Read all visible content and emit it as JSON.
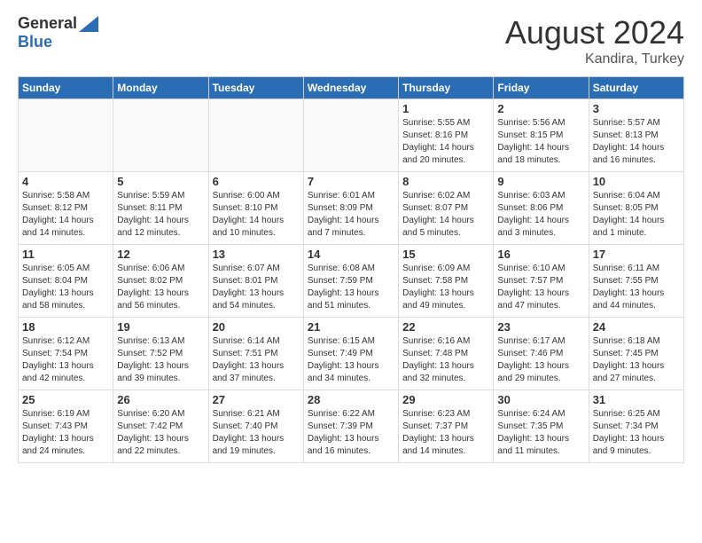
{
  "header": {
    "logo_general": "General",
    "logo_blue": "Blue",
    "month_year": "August 2024",
    "location": "Kandira, Turkey"
  },
  "days_of_week": [
    "Sunday",
    "Monday",
    "Tuesday",
    "Wednesday",
    "Thursday",
    "Friday",
    "Saturday"
  ],
  "weeks": [
    [
      {
        "day": "",
        "info": ""
      },
      {
        "day": "",
        "info": ""
      },
      {
        "day": "",
        "info": ""
      },
      {
        "day": "",
        "info": ""
      },
      {
        "day": "1",
        "info": "Sunrise: 5:55 AM\nSunset: 8:16 PM\nDaylight: 14 hours\nand 20 minutes."
      },
      {
        "day": "2",
        "info": "Sunrise: 5:56 AM\nSunset: 8:15 PM\nDaylight: 14 hours\nand 18 minutes."
      },
      {
        "day": "3",
        "info": "Sunrise: 5:57 AM\nSunset: 8:13 PM\nDaylight: 14 hours\nand 16 minutes."
      }
    ],
    [
      {
        "day": "4",
        "info": "Sunrise: 5:58 AM\nSunset: 8:12 PM\nDaylight: 14 hours\nand 14 minutes."
      },
      {
        "day": "5",
        "info": "Sunrise: 5:59 AM\nSunset: 8:11 PM\nDaylight: 14 hours\nand 12 minutes."
      },
      {
        "day": "6",
        "info": "Sunrise: 6:00 AM\nSunset: 8:10 PM\nDaylight: 14 hours\nand 10 minutes."
      },
      {
        "day": "7",
        "info": "Sunrise: 6:01 AM\nSunset: 8:09 PM\nDaylight: 14 hours\nand 7 minutes."
      },
      {
        "day": "8",
        "info": "Sunrise: 6:02 AM\nSunset: 8:07 PM\nDaylight: 14 hours\nand 5 minutes."
      },
      {
        "day": "9",
        "info": "Sunrise: 6:03 AM\nSunset: 8:06 PM\nDaylight: 14 hours\nand 3 minutes."
      },
      {
        "day": "10",
        "info": "Sunrise: 6:04 AM\nSunset: 8:05 PM\nDaylight: 14 hours\nand 1 minute."
      }
    ],
    [
      {
        "day": "11",
        "info": "Sunrise: 6:05 AM\nSunset: 8:04 PM\nDaylight: 13 hours\nand 58 minutes."
      },
      {
        "day": "12",
        "info": "Sunrise: 6:06 AM\nSunset: 8:02 PM\nDaylight: 13 hours\nand 56 minutes."
      },
      {
        "day": "13",
        "info": "Sunrise: 6:07 AM\nSunset: 8:01 PM\nDaylight: 13 hours\nand 54 minutes."
      },
      {
        "day": "14",
        "info": "Sunrise: 6:08 AM\nSunset: 7:59 PM\nDaylight: 13 hours\nand 51 minutes."
      },
      {
        "day": "15",
        "info": "Sunrise: 6:09 AM\nSunset: 7:58 PM\nDaylight: 13 hours\nand 49 minutes."
      },
      {
        "day": "16",
        "info": "Sunrise: 6:10 AM\nSunset: 7:57 PM\nDaylight: 13 hours\nand 47 minutes."
      },
      {
        "day": "17",
        "info": "Sunrise: 6:11 AM\nSunset: 7:55 PM\nDaylight: 13 hours\nand 44 minutes."
      }
    ],
    [
      {
        "day": "18",
        "info": "Sunrise: 6:12 AM\nSunset: 7:54 PM\nDaylight: 13 hours\nand 42 minutes."
      },
      {
        "day": "19",
        "info": "Sunrise: 6:13 AM\nSunset: 7:52 PM\nDaylight: 13 hours\nand 39 minutes."
      },
      {
        "day": "20",
        "info": "Sunrise: 6:14 AM\nSunset: 7:51 PM\nDaylight: 13 hours\nand 37 minutes."
      },
      {
        "day": "21",
        "info": "Sunrise: 6:15 AM\nSunset: 7:49 PM\nDaylight: 13 hours\nand 34 minutes."
      },
      {
        "day": "22",
        "info": "Sunrise: 6:16 AM\nSunset: 7:48 PM\nDaylight: 13 hours\nand 32 minutes."
      },
      {
        "day": "23",
        "info": "Sunrise: 6:17 AM\nSunset: 7:46 PM\nDaylight: 13 hours\nand 29 minutes."
      },
      {
        "day": "24",
        "info": "Sunrise: 6:18 AM\nSunset: 7:45 PM\nDaylight: 13 hours\nand 27 minutes."
      }
    ],
    [
      {
        "day": "25",
        "info": "Sunrise: 6:19 AM\nSunset: 7:43 PM\nDaylight: 13 hours\nand 24 minutes."
      },
      {
        "day": "26",
        "info": "Sunrise: 6:20 AM\nSunset: 7:42 PM\nDaylight: 13 hours\nand 22 minutes."
      },
      {
        "day": "27",
        "info": "Sunrise: 6:21 AM\nSunset: 7:40 PM\nDaylight: 13 hours\nand 19 minutes."
      },
      {
        "day": "28",
        "info": "Sunrise: 6:22 AM\nSunset: 7:39 PM\nDaylight: 13 hours\nand 16 minutes."
      },
      {
        "day": "29",
        "info": "Sunrise: 6:23 AM\nSunset: 7:37 PM\nDaylight: 13 hours\nand 14 minutes."
      },
      {
        "day": "30",
        "info": "Sunrise: 6:24 AM\nSunset: 7:35 PM\nDaylight: 13 hours\nand 11 minutes."
      },
      {
        "day": "31",
        "info": "Sunrise: 6:25 AM\nSunset: 7:34 PM\nDaylight: 13 hours\nand 9 minutes."
      }
    ]
  ]
}
